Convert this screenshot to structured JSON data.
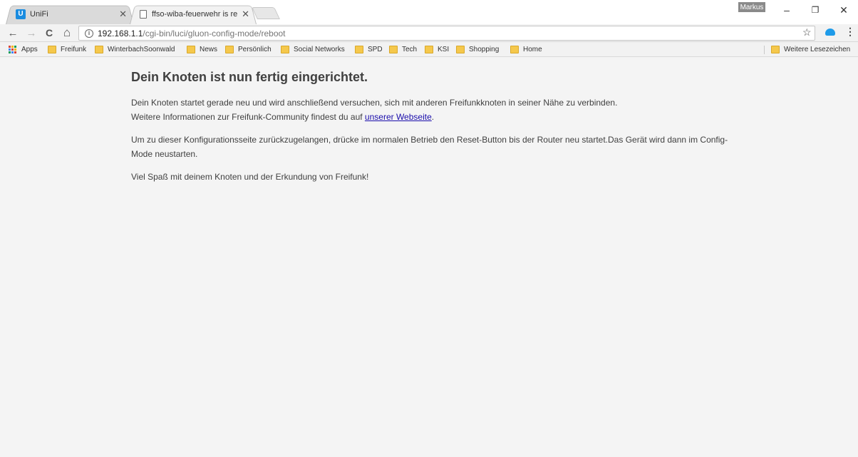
{
  "tabs": [
    {
      "title": "UniFi",
      "icon": "unifi-logo-icon",
      "icon_letter": "U",
      "active": false
    },
    {
      "title": "ffso-wiba-feuerwehr is re",
      "icon": "document-icon",
      "active": true
    }
  ],
  "window": {
    "profile": "Markus",
    "minimize": "–",
    "restore": "❐",
    "close": "✕"
  },
  "toolbar": {
    "back": "←",
    "forward": "→",
    "reload": "C",
    "home": "⌂",
    "info": "i",
    "url_host": "192.168.1.1",
    "url_path": "/cgi-bin/luci/gluon-config-mode/reboot",
    "star": "☆",
    "menu": "⋮"
  },
  "bookmarks": {
    "apps": "Apps",
    "items": [
      "Freifunk",
      "WinterbachSoonwald",
      "News",
      "Persönlich",
      "Social Networks",
      "SPD",
      "Tech",
      "KSI",
      "Shopping",
      "Home"
    ],
    "other": "Weitere Lesezeichen"
  },
  "page": {
    "heading": "Dein Knoten ist nun fertig eingerichtet.",
    "p1_line1": "Dein Knoten startet gerade neu und wird anschließend versuchen, sich mit anderen Freifunkknoten in seiner Nähe zu verbinden.",
    "p1_line2_prefix": "Weitere Informationen zur Freifunk-Community findest du auf ",
    "p1_link": "unserer Webseite",
    "p1_suffix": ".",
    "p2": "Um zu dieser Konfigurationsseite zurückzugelangen, drücke im normalen Betrieb den Reset-Button bis der Router neu startet.Das Gerät wird dann im Config-Mode neustarten.",
    "p3": "Viel Spaß mit deinem Knoten und der Erkundung von Freifunk!"
  },
  "colors": {
    "link": "#1a0dab",
    "folder": "#f5c84c",
    "unifi_blue": "#1a8ce0",
    "text": "#404040"
  }
}
